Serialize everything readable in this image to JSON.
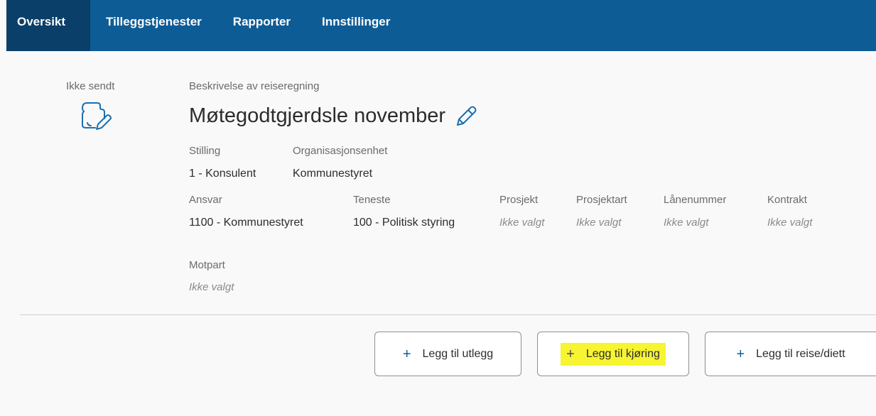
{
  "nav": {
    "tabs": [
      {
        "label": "Oversikt",
        "active": true
      },
      {
        "label": "Tilleggstjenester",
        "active": false
      },
      {
        "label": "Rapporter",
        "active": false
      },
      {
        "label": "Innstillinger",
        "active": false
      }
    ]
  },
  "status": {
    "label": "Ikke sendt",
    "icon": "document-edit-icon"
  },
  "description": {
    "label": "Beskrivelse av reiseregning",
    "title": "Møtegodtgjerdsle november",
    "edit_icon": "pencil-icon"
  },
  "fields": {
    "stilling": {
      "label": "Stilling",
      "value": "1 - Konsulent"
    },
    "organisasjonsenhet": {
      "label": "Organisasjonsenhet",
      "value": "Kommunestyret"
    },
    "ansvar": {
      "label": "Ansvar",
      "value": "1100 - Kommunestyret"
    },
    "teneste": {
      "label": "Teneste",
      "value": "100 - Politisk styring"
    },
    "prosjekt": {
      "label": "Prosjekt",
      "value": "Ikke valgt"
    },
    "prosjektart": {
      "label": "Prosjektart",
      "value": "Ikke valgt"
    },
    "lanenummer": {
      "label": "Lånenummer",
      "value": "Ikke valgt"
    },
    "kontrakt": {
      "label": "Kontrakt",
      "value": "Ikke valgt"
    },
    "motpart": {
      "label": "Motpart",
      "value": "Ikke valgt"
    }
  },
  "actions": {
    "plus_symbol": "+",
    "add_expense": "Legg til utlegg",
    "add_driving": "Legg til kjøring",
    "add_travel": "Legg til reise/diett"
  },
  "colors": {
    "nav_background": "#0e5c96",
    "nav_active": "#0a3f69",
    "highlight": "#f7f432",
    "accent": "#0e5c96"
  }
}
